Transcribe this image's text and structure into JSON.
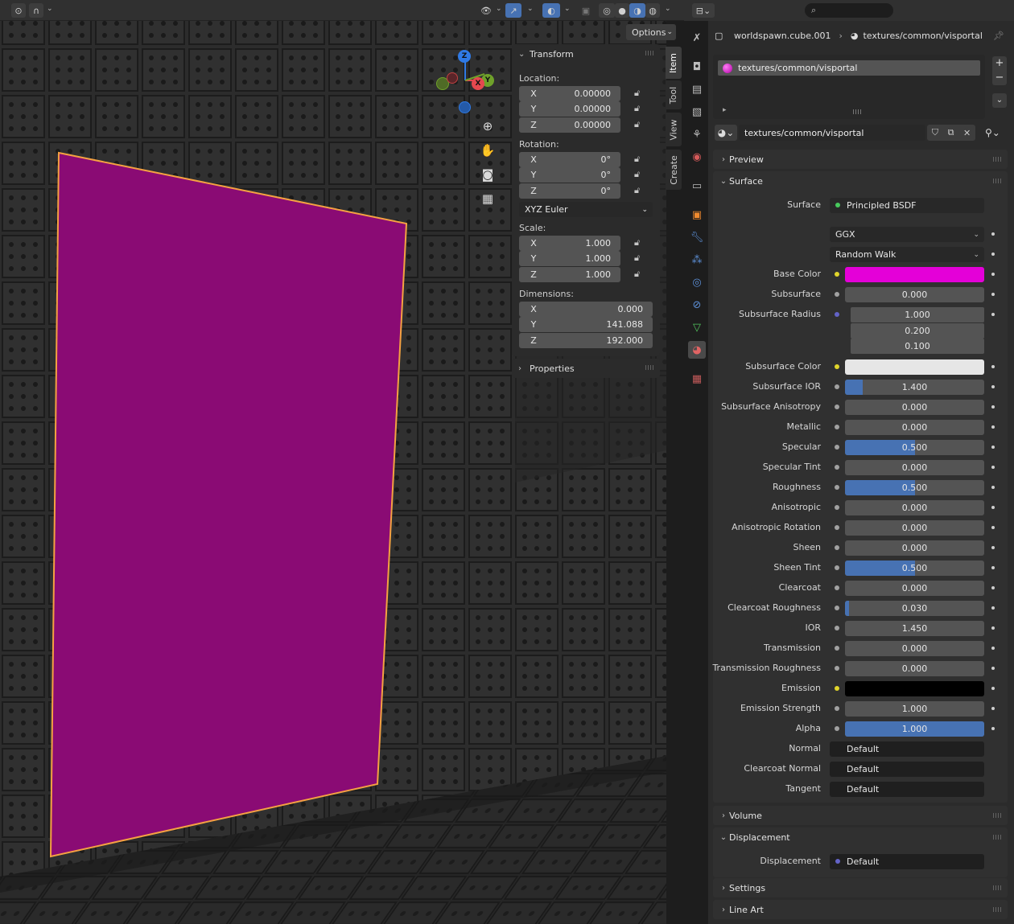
{
  "viewport": {
    "header": {
      "options_label": "Options"
    },
    "gizmo": {
      "z_label": "Z",
      "y_label": "Y",
      "x_label": "X"
    },
    "sidebar_tabs": [
      "Item",
      "Tool",
      "View",
      "Create"
    ],
    "transform": {
      "title": "Transform",
      "location_label": "Location:",
      "location": [
        {
          "axis": "X",
          "value": "0.00000"
        },
        {
          "axis": "Y",
          "value": "0.00000"
        },
        {
          "axis": "Z",
          "value": "0.00000"
        }
      ],
      "rotation_label": "Rotation:",
      "rotation": [
        {
          "axis": "X",
          "value": "0°"
        },
        {
          "axis": "Y",
          "value": "0°"
        },
        {
          "axis": "Z",
          "value": "0°"
        }
      ],
      "rotation_mode": "XYZ Euler",
      "scale_label": "Scale:",
      "scale": [
        {
          "axis": "X",
          "value": "1.000"
        },
        {
          "axis": "Y",
          "value": "1.000"
        },
        {
          "axis": "Z",
          "value": "1.000"
        }
      ],
      "dimensions_label": "Dimensions:",
      "dimensions": [
        {
          "axis": "X",
          "value": "0.000"
        },
        {
          "axis": "Y",
          "value": "141.088"
        },
        {
          "axis": "Z",
          "value": "192.000"
        }
      ]
    },
    "properties_panel_title": "Properties"
  },
  "props": {
    "breadcrumb": {
      "object": "worldspawn.cube.001",
      "material": "textures/common/visportal"
    },
    "slot_item": "textures/common/visportal",
    "material_name": "textures/common/visportal",
    "sections": {
      "preview": "Preview",
      "surface": "Surface",
      "volume": "Volume",
      "displacement": "Displacement",
      "settings": "Settings",
      "line_art": "Line Art"
    },
    "surface_label": "Surface",
    "surface_shader": "Principled BSDF",
    "distribution": "GGX",
    "subsurface_method": "Random Walk",
    "fields": [
      {
        "label": "Base Color",
        "type": "color",
        "color": "#e400d8",
        "socket": "y"
      },
      {
        "label": "Subsurface",
        "value": "0.000",
        "fill": 0,
        "socket": "g"
      },
      {
        "label": "Subsurface Radius",
        "type": "vector",
        "values": [
          "1.000",
          "0.200",
          "0.100"
        ],
        "socket": "p"
      },
      {
        "label": "Subsurface Color",
        "type": "color",
        "color": "#e6e6e6",
        "socket": "y"
      },
      {
        "label": "Subsurface IOR",
        "value": "1.400",
        "fill": 0.13,
        "socket": "g"
      },
      {
        "label": "Subsurface Anisotropy",
        "value": "0.000",
        "fill": 0,
        "socket": "g"
      },
      {
        "label": "Metallic",
        "value": "0.000",
        "fill": 0,
        "socket": "g"
      },
      {
        "label": "Specular",
        "value": "0.500",
        "fill": 0.5,
        "socket": "g"
      },
      {
        "label": "Specular Tint",
        "value": "0.000",
        "fill": 0,
        "socket": "g"
      },
      {
        "label": "Roughness",
        "value": "0.500",
        "fill": 0.5,
        "socket": "g"
      },
      {
        "label": "Anisotropic",
        "value": "0.000",
        "fill": 0,
        "socket": "g"
      },
      {
        "label": "Anisotropic Rotation",
        "value": "0.000",
        "fill": 0,
        "socket": "g"
      },
      {
        "label": "Sheen",
        "value": "0.000",
        "fill": 0,
        "socket": "g"
      },
      {
        "label": "Sheen Tint",
        "value": "0.500",
        "fill": 0.5,
        "socket": "g"
      },
      {
        "label": "Clearcoat",
        "value": "0.000",
        "fill": 0,
        "socket": "g"
      },
      {
        "label": "Clearcoat Roughness",
        "value": "0.030",
        "fill": 0.03,
        "socket": "g"
      },
      {
        "label": "IOR",
        "value": "1.450",
        "fill": 0,
        "socket": "g"
      },
      {
        "label": "Transmission",
        "value": "0.000",
        "fill": 0,
        "socket": "g"
      },
      {
        "label": "Transmission Roughness",
        "value": "0.000",
        "fill": 0,
        "socket": "g"
      },
      {
        "label": "Emission",
        "type": "color",
        "color": "#000000",
        "socket": "y"
      },
      {
        "label": "Emission Strength",
        "value": "1.000",
        "fill": 0,
        "socket": "g"
      },
      {
        "label": "Alpha",
        "value": "1.000",
        "fill": 1,
        "socket": "g"
      },
      {
        "label": "Normal",
        "type": "link",
        "value": "Default",
        "socket": "p"
      },
      {
        "label": "Clearcoat Normal",
        "type": "link",
        "value": "Default",
        "socket": "p"
      },
      {
        "label": "Tangent",
        "type": "link",
        "value": "Default",
        "socket": "p"
      }
    ],
    "displacement_label": "Displacement",
    "displacement_value": "Default"
  },
  "colors": {
    "accent": "#4772b3",
    "portal": "#8a0b74",
    "outline": "#f5a142"
  }
}
